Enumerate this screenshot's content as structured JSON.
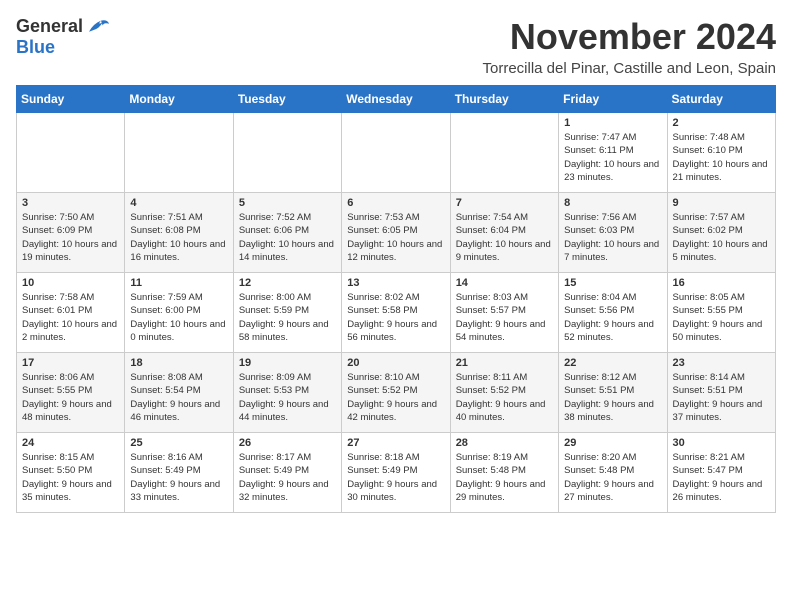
{
  "header": {
    "logo_general": "General",
    "logo_blue": "Blue",
    "month": "November 2024",
    "location": "Torrecilla del Pinar, Castille and Leon, Spain"
  },
  "weekdays": [
    "Sunday",
    "Monday",
    "Tuesday",
    "Wednesday",
    "Thursday",
    "Friday",
    "Saturday"
  ],
  "weeks": [
    [
      {
        "day": "",
        "info": ""
      },
      {
        "day": "",
        "info": ""
      },
      {
        "day": "",
        "info": ""
      },
      {
        "day": "",
        "info": ""
      },
      {
        "day": "",
        "info": ""
      },
      {
        "day": "1",
        "info": "Sunrise: 7:47 AM\nSunset: 6:11 PM\nDaylight: 10 hours and 23 minutes."
      },
      {
        "day": "2",
        "info": "Sunrise: 7:48 AM\nSunset: 6:10 PM\nDaylight: 10 hours and 21 minutes."
      }
    ],
    [
      {
        "day": "3",
        "info": "Sunrise: 7:50 AM\nSunset: 6:09 PM\nDaylight: 10 hours and 19 minutes."
      },
      {
        "day": "4",
        "info": "Sunrise: 7:51 AM\nSunset: 6:08 PM\nDaylight: 10 hours and 16 minutes."
      },
      {
        "day": "5",
        "info": "Sunrise: 7:52 AM\nSunset: 6:06 PM\nDaylight: 10 hours and 14 minutes."
      },
      {
        "day": "6",
        "info": "Sunrise: 7:53 AM\nSunset: 6:05 PM\nDaylight: 10 hours and 12 minutes."
      },
      {
        "day": "7",
        "info": "Sunrise: 7:54 AM\nSunset: 6:04 PM\nDaylight: 10 hours and 9 minutes."
      },
      {
        "day": "8",
        "info": "Sunrise: 7:56 AM\nSunset: 6:03 PM\nDaylight: 10 hours and 7 minutes."
      },
      {
        "day": "9",
        "info": "Sunrise: 7:57 AM\nSunset: 6:02 PM\nDaylight: 10 hours and 5 minutes."
      }
    ],
    [
      {
        "day": "10",
        "info": "Sunrise: 7:58 AM\nSunset: 6:01 PM\nDaylight: 10 hours and 2 minutes."
      },
      {
        "day": "11",
        "info": "Sunrise: 7:59 AM\nSunset: 6:00 PM\nDaylight: 10 hours and 0 minutes."
      },
      {
        "day": "12",
        "info": "Sunrise: 8:00 AM\nSunset: 5:59 PM\nDaylight: 9 hours and 58 minutes."
      },
      {
        "day": "13",
        "info": "Sunrise: 8:02 AM\nSunset: 5:58 PM\nDaylight: 9 hours and 56 minutes."
      },
      {
        "day": "14",
        "info": "Sunrise: 8:03 AM\nSunset: 5:57 PM\nDaylight: 9 hours and 54 minutes."
      },
      {
        "day": "15",
        "info": "Sunrise: 8:04 AM\nSunset: 5:56 PM\nDaylight: 9 hours and 52 minutes."
      },
      {
        "day": "16",
        "info": "Sunrise: 8:05 AM\nSunset: 5:55 PM\nDaylight: 9 hours and 50 minutes."
      }
    ],
    [
      {
        "day": "17",
        "info": "Sunrise: 8:06 AM\nSunset: 5:55 PM\nDaylight: 9 hours and 48 minutes."
      },
      {
        "day": "18",
        "info": "Sunrise: 8:08 AM\nSunset: 5:54 PM\nDaylight: 9 hours and 46 minutes."
      },
      {
        "day": "19",
        "info": "Sunrise: 8:09 AM\nSunset: 5:53 PM\nDaylight: 9 hours and 44 minutes."
      },
      {
        "day": "20",
        "info": "Sunrise: 8:10 AM\nSunset: 5:52 PM\nDaylight: 9 hours and 42 minutes."
      },
      {
        "day": "21",
        "info": "Sunrise: 8:11 AM\nSunset: 5:52 PM\nDaylight: 9 hours and 40 minutes."
      },
      {
        "day": "22",
        "info": "Sunrise: 8:12 AM\nSunset: 5:51 PM\nDaylight: 9 hours and 38 minutes."
      },
      {
        "day": "23",
        "info": "Sunrise: 8:14 AM\nSunset: 5:51 PM\nDaylight: 9 hours and 37 minutes."
      }
    ],
    [
      {
        "day": "24",
        "info": "Sunrise: 8:15 AM\nSunset: 5:50 PM\nDaylight: 9 hours and 35 minutes."
      },
      {
        "day": "25",
        "info": "Sunrise: 8:16 AM\nSunset: 5:49 PM\nDaylight: 9 hours and 33 minutes."
      },
      {
        "day": "26",
        "info": "Sunrise: 8:17 AM\nSunset: 5:49 PM\nDaylight: 9 hours and 32 minutes."
      },
      {
        "day": "27",
        "info": "Sunrise: 8:18 AM\nSunset: 5:49 PM\nDaylight: 9 hours and 30 minutes."
      },
      {
        "day": "28",
        "info": "Sunrise: 8:19 AM\nSunset: 5:48 PM\nDaylight: 9 hours and 29 minutes."
      },
      {
        "day": "29",
        "info": "Sunrise: 8:20 AM\nSunset: 5:48 PM\nDaylight: 9 hours and 27 minutes."
      },
      {
        "day": "30",
        "info": "Sunrise: 8:21 AM\nSunset: 5:47 PM\nDaylight: 9 hours and 26 minutes."
      }
    ]
  ]
}
